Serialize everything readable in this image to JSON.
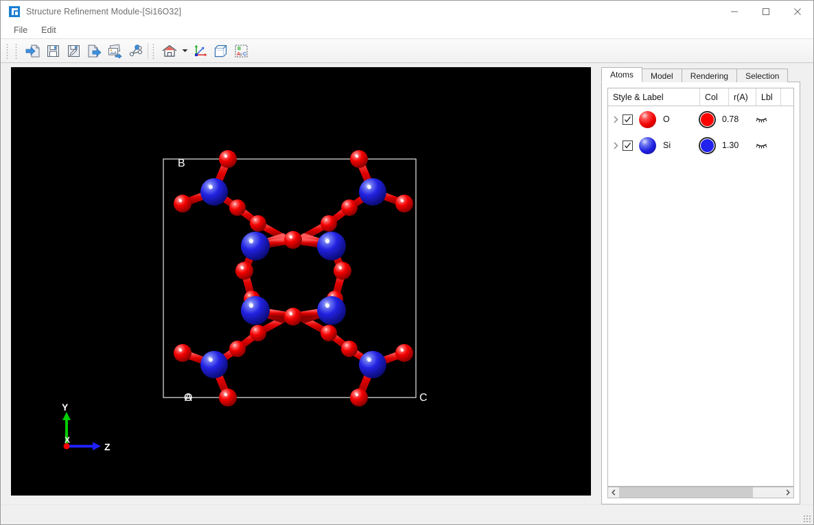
{
  "window": {
    "title": "Structure Refinement Module-[Si16O32]",
    "app_icon": "app-logo-icon",
    "minimize_label": "minimize-icon",
    "maximize_label": "maximize-icon",
    "close_label": "close-icon"
  },
  "menu": {
    "items": [
      {
        "label": "File"
      },
      {
        "label": "Edit"
      }
    ]
  },
  "toolbar": {
    "groups": [
      {
        "buttons": [
          {
            "icon": "import-structure-icon",
            "title": "Import"
          },
          {
            "icon": "save-icon",
            "title": "Save"
          },
          {
            "icon": "save-as-icon",
            "title": "Save As"
          },
          {
            "icon": "export-icon",
            "title": "Export"
          },
          {
            "icon": "export-image-icon",
            "title": "Export Image"
          },
          {
            "icon": "molecule-icon",
            "title": "Molecule"
          }
        ]
      },
      {
        "buttons": [
          {
            "icon": "home-view-icon",
            "title": "Home View",
            "has_caret": true
          },
          {
            "icon": "axes-icon",
            "title": "Show Axes"
          },
          {
            "icon": "unit-cell-icon",
            "title": "Show Unit Cell"
          },
          {
            "icon": "cell-axes-labels-icon",
            "title": "Cell Axis Labels"
          }
        ]
      }
    ],
    "caret": "chevron-down-icon"
  },
  "viewport": {
    "background": "#000000",
    "cell_labels": {
      "b": "B",
      "a": "A",
      "c": "C",
      "origin": "O"
    },
    "axis_triad": {
      "y": {
        "label": "Y",
        "color": "#00d000"
      },
      "z": {
        "label": "Z",
        "color": "#2020ff"
      },
      "x": {
        "label": "X",
        "color": "#ff0000"
      }
    },
    "atom_colors": {
      "O": "#ff0000",
      "Si": "#2222ee"
    },
    "cell_edge_color": "#d8d8d8"
  },
  "panel": {
    "tabs": [
      {
        "label": "Atoms",
        "active": true
      },
      {
        "label": "Model",
        "active": false
      },
      {
        "label": "Rendering",
        "active": false
      },
      {
        "label": "Selection",
        "active": false
      }
    ],
    "table": {
      "headers": [
        {
          "label": "Style & Label"
        },
        {
          "label": "Col"
        },
        {
          "label": "r(A)"
        },
        {
          "label": "Lbl"
        },
        {
          "label": ""
        }
      ],
      "rows": [
        {
          "expander": "chevron-right-icon",
          "checked": true,
          "element": "O",
          "sphere_class": "o",
          "color": "#ff0000",
          "radius": "0.78",
          "label_icon": "eye-closed-icon"
        },
        {
          "expander": "chevron-right-icon",
          "checked": true,
          "element": "Si",
          "sphere_class": "si",
          "color": "#2222ee",
          "radius": "1.30",
          "label_icon": "eye-closed-icon"
        }
      ]
    },
    "scrollbar": {
      "left_arrow": "chevron-left-icon",
      "right_arrow": "chevron-right-icon"
    }
  },
  "statusbar": {
    "text": "",
    "resize_grip": "resize-grip-icon"
  }
}
